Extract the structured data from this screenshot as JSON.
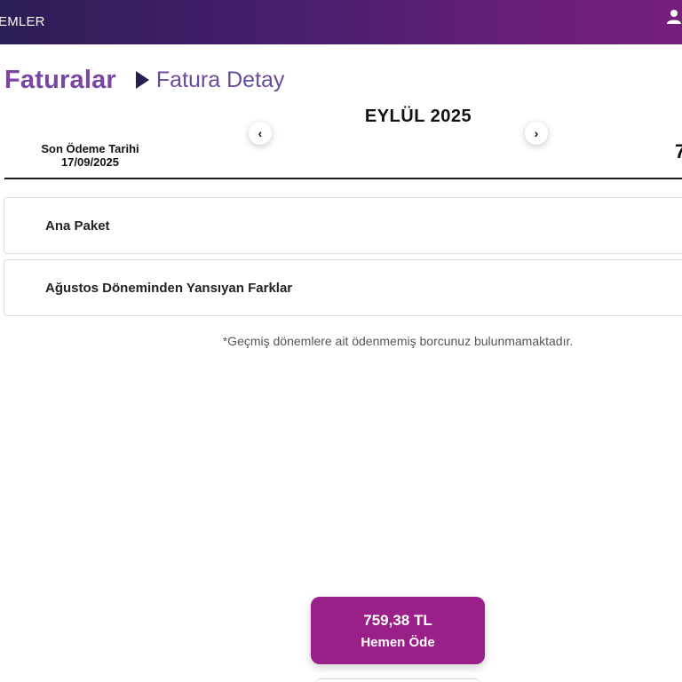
{
  "header": {
    "nav_text": "EMLER",
    "user_icon": "user-icon"
  },
  "breadcrumb": {
    "title": "Faturalar",
    "arrow_icon": "triangle-right-icon",
    "current": "Fatura Detay"
  },
  "period": {
    "month_label": "EYLÜL 2025",
    "prev_icon": "chevron-left-icon",
    "next_icon": "chevron-right-icon"
  },
  "due": {
    "label": "Son Ödeme Tarihi",
    "date": "17/09/2025",
    "cut_value": "7"
  },
  "sections": [
    {
      "label": "Ana Paket"
    },
    {
      "label": "Ağustos Döneminden Yansıyan Farklar"
    }
  ],
  "note": "*Geçmiş dönemlere ait ödenmemiş borcunuz bulunmamaktadır.",
  "payment": {
    "amount": "759,38 TL",
    "label": "Hemen Öde"
  },
  "colors": {
    "header_start": "#2b1d55",
    "header_end": "#751f7c",
    "title": "#7a45a3",
    "pay_button": "#9b1f88"
  }
}
